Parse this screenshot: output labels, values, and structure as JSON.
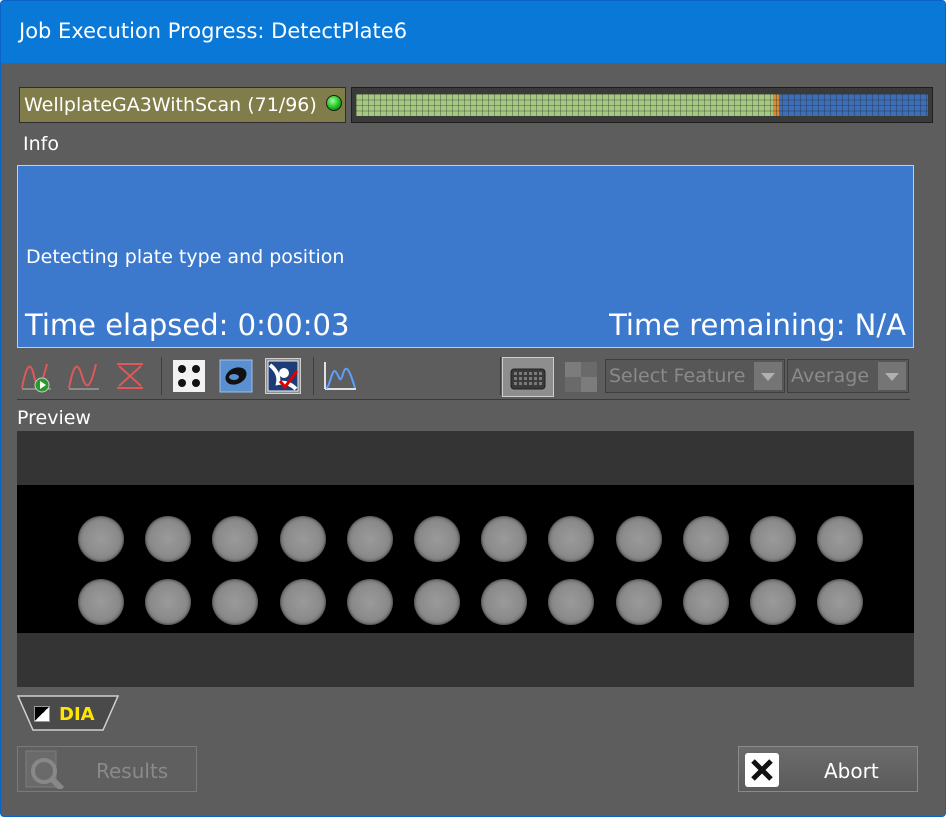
{
  "window": {
    "title": "Job Execution Progress: DetectPlate6"
  },
  "job": {
    "name_label": "WellplateGA3WithScan (71/96)",
    "status_color": "#18c418",
    "progress": {
      "completed": 71,
      "total": 96,
      "fraction": 0.74
    }
  },
  "info": {
    "section_label": "Info",
    "message": "Detecting plate type and position",
    "elapsed": "Time elapsed: 0:00:03",
    "remaining": "Time remaining: N/A"
  },
  "toolbar": {
    "icons": [
      "curve-play-icon",
      "curve-icon",
      "curve-clear-icon",
      "dots-icon",
      "blob-icon",
      "check-overlay-icon",
      "histogram-icon",
      "plate-grid-icon",
      "checker-icon"
    ],
    "feature_select": "Select Feature",
    "mode_select": "Average"
  },
  "preview": {
    "section_label": "Preview",
    "rows": 2,
    "columns": 12
  },
  "channel_tab": {
    "label": "DIA"
  },
  "buttons": {
    "results": "Results",
    "abort": "Abort"
  }
}
